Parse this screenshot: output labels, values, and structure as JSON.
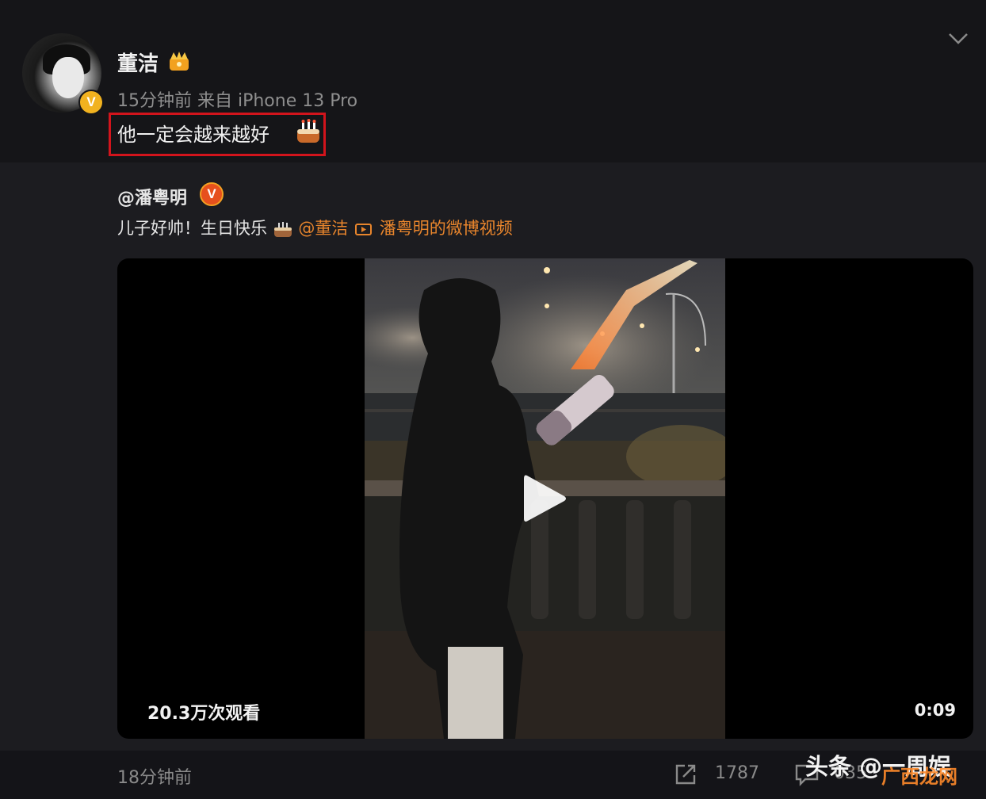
{
  "post": {
    "username": "董洁",
    "meta": "15分钟前 来自 iPhone 13 Pro",
    "content": "他一定会越来越好",
    "verified_mark": "V"
  },
  "repost": {
    "username": "@潘粤明",
    "verified_mark": "V",
    "text": "儿子好帅！生日快乐",
    "mention": "@董洁",
    "video_link": "潘粤明的微博视频"
  },
  "video": {
    "view_count": "20.3万次观看",
    "duration": "0:09"
  },
  "footer": {
    "time": "18分钟前",
    "share_count": "1787",
    "comment_count": "035"
  },
  "watermark": {
    "text": "头条 @一周娱",
    "site": "广西龙网"
  },
  "colors": {
    "highlight_border": "#d2141c",
    "link": "#e8852c",
    "badge_gold": "#f1b21f"
  }
}
